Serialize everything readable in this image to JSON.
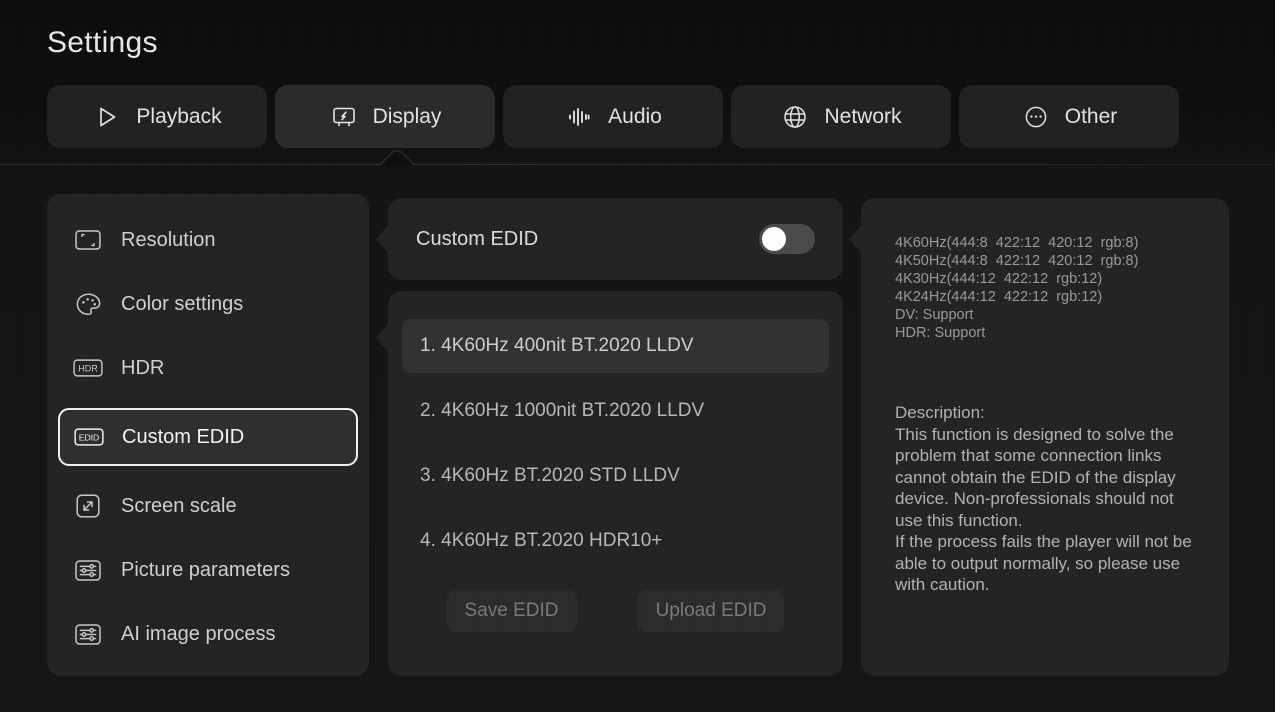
{
  "header": {
    "title": "Settings",
    "tabs": [
      {
        "label": "Playback",
        "icon": "play-triangle-icon",
        "active": false
      },
      {
        "label": "Display",
        "icon": "monitor-bolt-icon",
        "active": true
      },
      {
        "label": "Audio",
        "icon": "waveform-icon",
        "active": false
      },
      {
        "label": "Network",
        "icon": "globe-icon",
        "active": false
      },
      {
        "label": "Other",
        "icon": "ellipsis-circle-icon",
        "active": false
      }
    ]
  },
  "sidebar": {
    "items": [
      {
        "label": "Resolution",
        "icon": "screen-corners-icon",
        "selected": false
      },
      {
        "label": "Color settings",
        "icon": "palette-icon",
        "selected": false
      },
      {
        "label": "HDR",
        "icon": "hdr-badge-icon",
        "selected": false
      },
      {
        "label": "Custom EDID",
        "icon": "edid-badge-icon",
        "selected": true
      },
      {
        "label": "Screen scale",
        "icon": "expand-arrows-icon",
        "selected": false
      },
      {
        "label": "Picture parameters",
        "icon": "sliders-icon",
        "selected": false
      },
      {
        "label": "AI image process",
        "icon": "sliders-icon",
        "selected": false
      }
    ]
  },
  "main": {
    "toggle": {
      "label": "Custom EDID",
      "state": "off"
    },
    "edid_presets": [
      {
        "label": "1. 4K60Hz 400nit BT.2020 LLDV",
        "highlighted": true
      },
      {
        "label": "2. 4K60Hz 1000nit BT.2020 LLDV",
        "highlighted": false
      },
      {
        "label": "3. 4K60Hz BT.2020 STD LLDV",
        "highlighted": false
      },
      {
        "label": "4. 4K60Hz BT.2020 HDR10+",
        "highlighted": false
      }
    ],
    "buttons": {
      "save": "Save EDID",
      "upload": "Upload EDID"
    }
  },
  "info": {
    "tech_lines": [
      "4K60Hz(444:8  422:12  420:12  rgb:8)",
      "4K50Hz(444:8  422:12  420:12  rgb:8)",
      "4K30Hz(444:12  422:12  rgb:12)",
      "4K24Hz(444:12  422:12  rgb:12)",
      "DV: Support",
      "HDR: Support"
    ],
    "description_heading": "Description:",
    "description_paragraph_1": "This function is designed to solve the problem that some connection links cannot obtain the EDID of the display device. Non-professionals should not use this function.",
    "description_paragraph_2": "If the process fails the player will not be able to output normally, so please use with caution."
  },
  "colors": {
    "background": "#101010",
    "panel": "#242424",
    "tab_active": "#2b2b2b",
    "selected_border": "#f2f2f2",
    "switch_knob": "#ffffff",
    "switch_track": "#4b4b4b",
    "text_primary": "#e4e4e4",
    "text_secondary": "#b4b4b4",
    "text_disabled": "#7b7b7b"
  }
}
